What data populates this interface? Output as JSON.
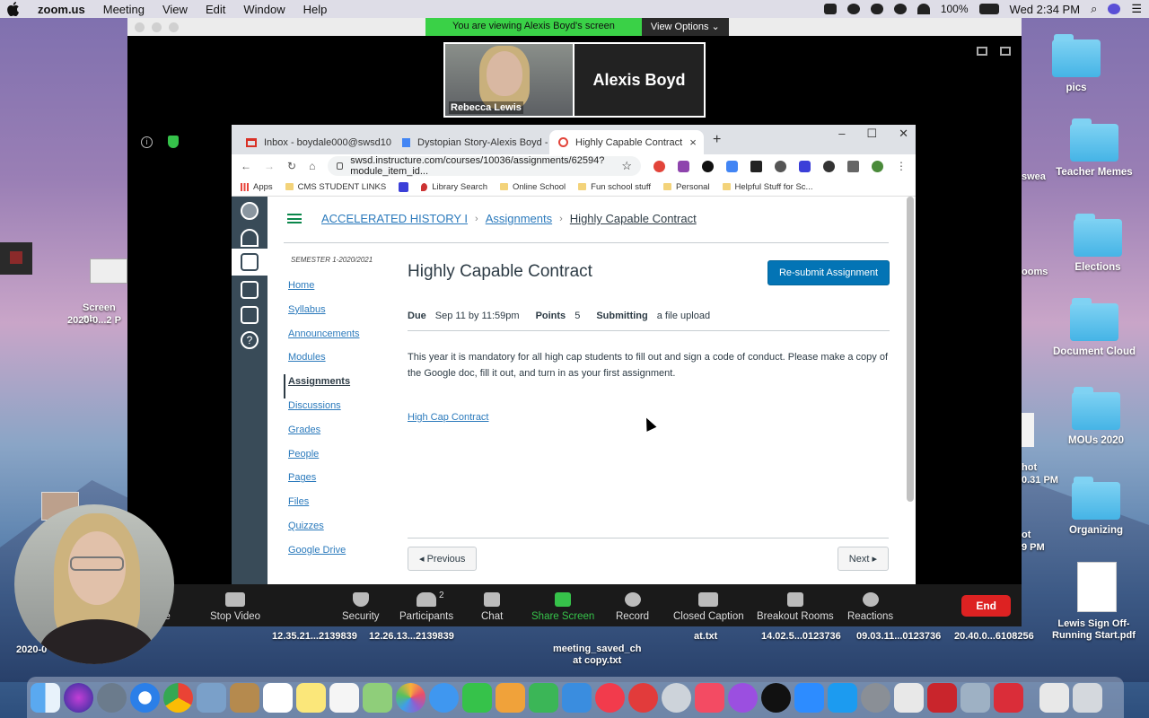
{
  "menubar": {
    "app": "zoom.us",
    "menus": [
      "Meeting",
      "View",
      "Edit",
      "Window",
      "Help"
    ],
    "battery": "100%",
    "clock": "Wed 2:34 PM"
  },
  "desktop": {
    "right_icons": [
      {
        "label": "pics"
      },
      {
        "label": "Teacher Memes"
      },
      {
        "label": "Elections"
      },
      {
        "label": "Document Cloud"
      },
      {
        "label": "MOUs 2020"
      },
      {
        "label": "Organizing"
      }
    ],
    "partial_labels": [
      "swea",
      "ooms",
      "hot",
      "0.31 PM",
      "ot",
      "9 PM"
    ],
    "left_partial": {
      "label1": "Screen Sh",
      "label2": "2020-0...2 P"
    },
    "file_labels": [
      {
        "l1": "12.35.21...2139839"
      },
      {
        "l1": "12.26.13...2139839"
      },
      {
        "l1": "meeting_saved_ch",
        "l2": "at copy.txt"
      },
      {
        "l1": "at.txt"
      },
      {
        "l1": "14.02.5...0123736"
      },
      {
        "l1": "09.03.11...0123736"
      },
      {
        "l1": "20.40.0...6108256"
      },
      {
        "l1": "Lewis Sign Off-",
        "l2": "Running Start.pdf"
      }
    ],
    "left_bottom": "2020-0"
  },
  "zoom": {
    "banner": "You are viewing Alexis Boyd's screen",
    "view_options": "View Options",
    "participant1": "Rebecca Lewis",
    "participant2": "Alexis Boyd",
    "controls": [
      {
        "label": "te",
        "name": "unmute-partial"
      },
      {
        "label": "Stop Video",
        "name": "stop-video"
      },
      {
        "label": "Security",
        "name": "security"
      },
      {
        "label": "Participants",
        "name": "participants",
        "badge": "2"
      },
      {
        "label": "Chat",
        "name": "chat"
      },
      {
        "label": "Share Screen",
        "name": "share-screen"
      },
      {
        "label": "Record",
        "name": "record"
      },
      {
        "label": "Closed Caption",
        "name": "closed-caption"
      },
      {
        "label": "Breakout Rooms",
        "name": "breakout-rooms"
      },
      {
        "label": "Reactions",
        "name": "reactions"
      }
    ],
    "end": "End"
  },
  "browser": {
    "tabs": [
      {
        "title": "Inbox - boydale000@swsd101.or"
      },
      {
        "title": "Dystopian Story-Alexis Boyd - Go"
      },
      {
        "title": "Highly Capable Contract"
      }
    ],
    "url": "swsd.instructure.com/courses/10036/assignments/62594?module_item_id...",
    "bookmarks": [
      "Apps",
      "CMS STUDENT LINKS",
      "Library Search",
      "Online School",
      "Fun school stuff",
      "Personal",
      "Helpful Stuff for Sc..."
    ]
  },
  "canvas": {
    "breadcrumb": [
      "ACCELERATED HISTORY I",
      "Assignments",
      "Highly Capable Contract"
    ],
    "semester": "SEMESTER 1-2020/2021",
    "nav": [
      "Home",
      "Syllabus",
      "Announcements",
      "Modules",
      "Assignments",
      "Discussions",
      "Grades",
      "People",
      "Pages",
      "Files",
      "Quizzes",
      "Google Drive"
    ],
    "active_nav": "Assignments",
    "title": "Highly Capable Contract",
    "resubmit": "Re-submit Assignment",
    "due_label": "Due",
    "due_value": "Sep 11 by 11:59pm",
    "points_label": "Points",
    "points_value": "5",
    "submitting_label": "Submitting",
    "submitting_value": "a file upload",
    "description": "This year it is mandatory for all high cap students to fill out and sign a code of conduct.  Please make a copy of the Google doc, fill it out, and turn in as your first assignment.",
    "link": "High Cap Contract",
    "prev": "◂ Previous",
    "next": "Next ▸"
  }
}
